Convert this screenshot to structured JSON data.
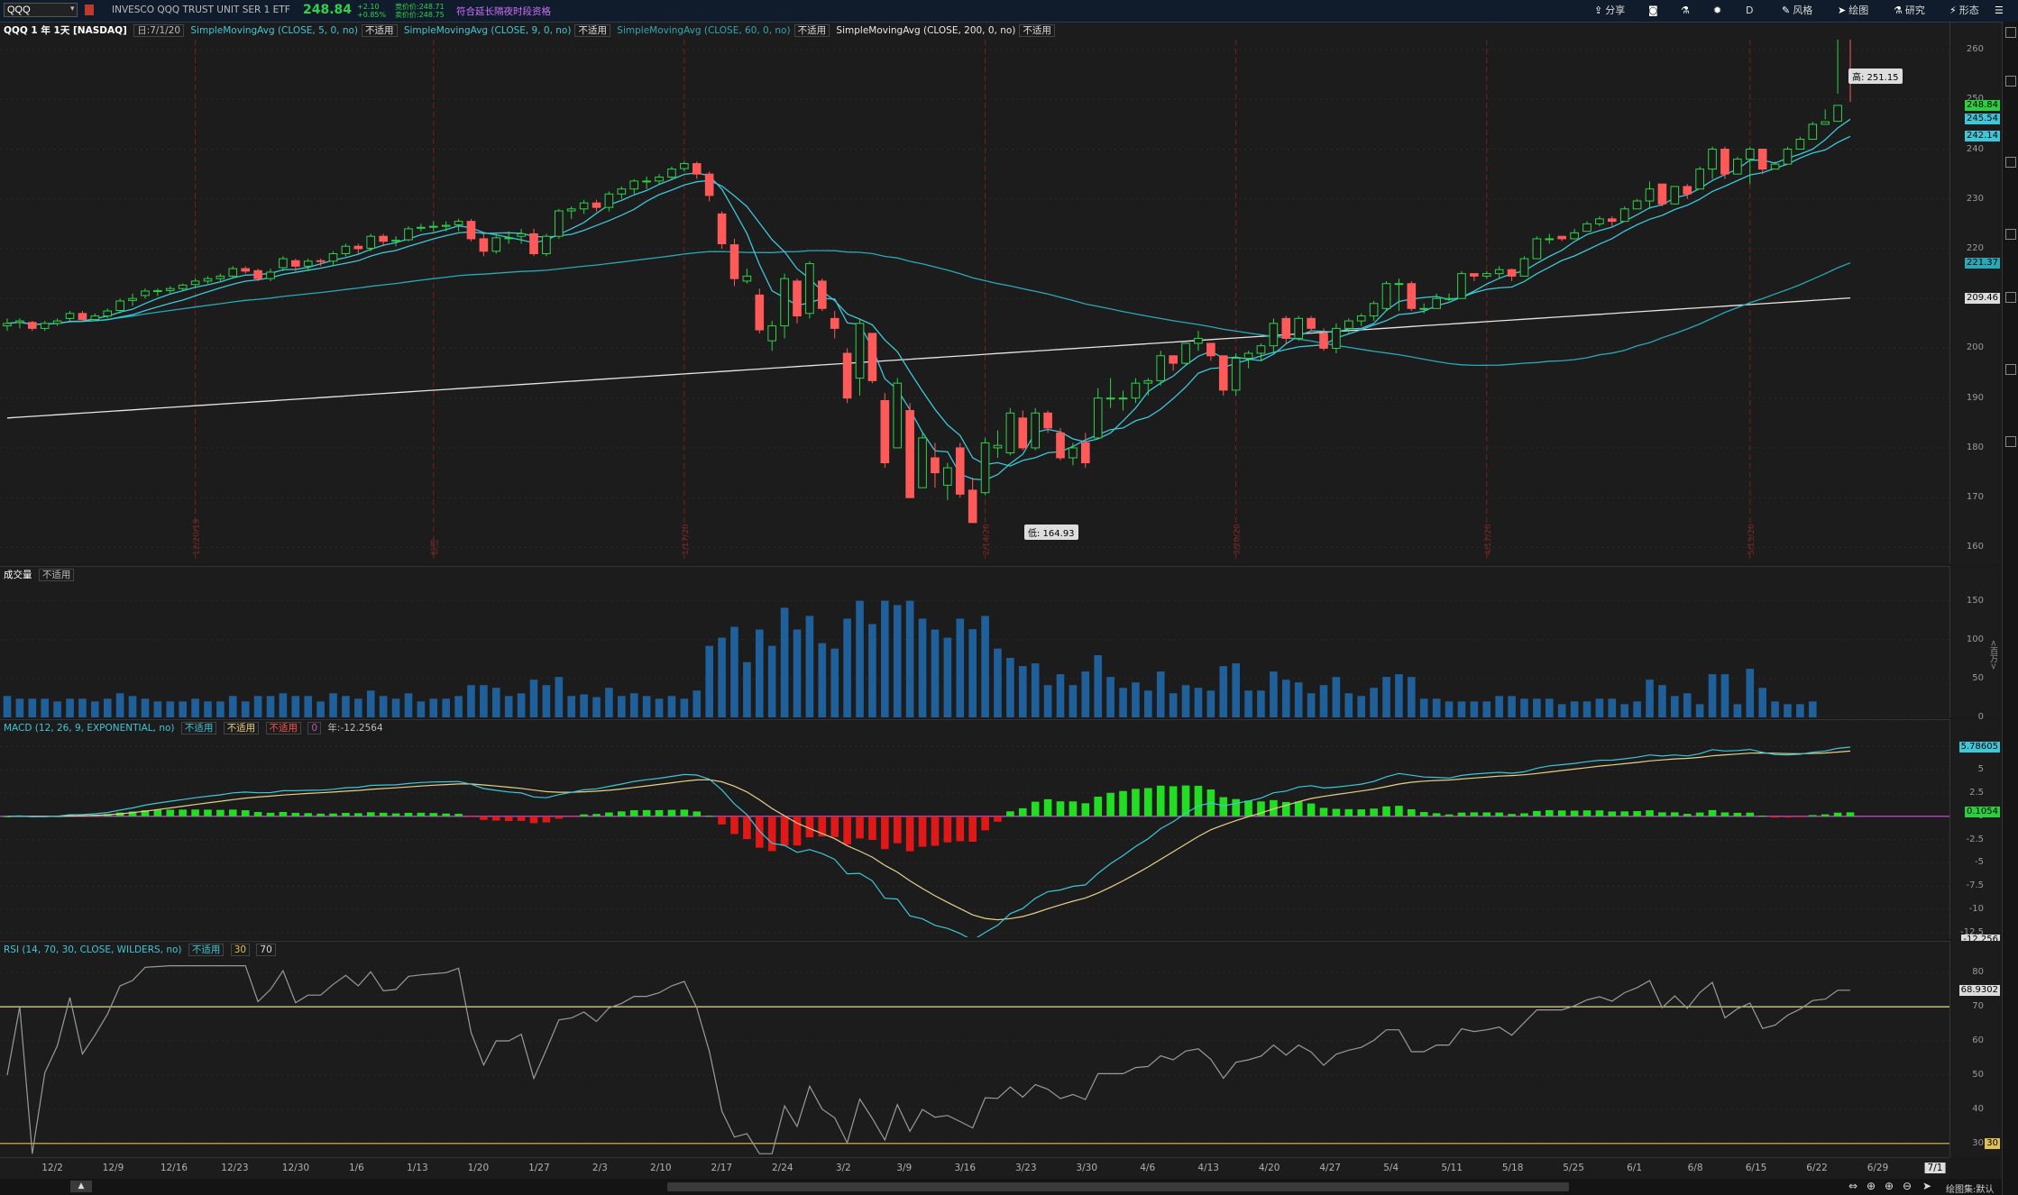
{
  "toolbar": {
    "symbol": "QQQ",
    "description": "INVESCO QQQ TRUST UNIT SER 1 ETF",
    "last": "248.84",
    "change": "+2.10",
    "change_pct": "+0.85%",
    "bid": "竞价价:248.71",
    "ask": "卖价价:248.75",
    "notice": "符合延长隔夜时段资格",
    "share_label": "分享",
    "style_label": "风格",
    "draw_label": "绘图",
    "study_label": "研究",
    "pattern_label": "形态",
    "period_label": "D"
  },
  "header": {
    "title": "QQQ 1 年 1天 [NASDAQ]",
    "date": "日:7/1/20",
    "studies": [
      {
        "name": "SimpleMovingAvg (CLOSE, 5, 0, no)",
        "value": "不适用"
      },
      {
        "name": "SimpleMovingAvg (CLOSE, 9, 0, no)",
        "value": "不适用"
      },
      {
        "name": "SimpleMovingAvg (CLOSE, 60, 0, no)",
        "value": "不适用"
      },
      {
        "name": "SimpleMovingAvg (CLOSE, 200, 0, no)",
        "value": "不适用"
      }
    ]
  },
  "price_panel": {
    "y_ticks": [
      "260",
      "250",
      "240",
      "230",
      "220",
      "210",
      "200",
      "190",
      "180",
      "170",
      "160"
    ],
    "high_label": "高: 251.15",
    "low_label": "低: 164.93",
    "badges": [
      {
        "text": "248.84",
        "color": "#29d040"
      },
      {
        "text": "245.54",
        "color": "#3fc6d8"
      },
      {
        "text": "242.14",
        "color": "#3fc6d8"
      },
      {
        "text": "221.37",
        "color": "#2aa8b8"
      },
      {
        "text": "209.46",
        "color": "#dcdcdc"
      }
    ],
    "vertical_date_labels": [
      "12/20/19",
      "标签",
      "1/17/20",
      "2/14/20",
      "3/20/20",
      "4/17/20",
      "5/15/20",
      "6/19/20"
    ]
  },
  "volume_panel": {
    "title": "成交量",
    "value": "不适用",
    "y_ticks": [
      "150",
      "100",
      "50",
      "0"
    ],
    "unit": "<百万>"
  },
  "macd_panel": {
    "title": "MACD (12, 26, 9, EXPONENTIAL, no)",
    "values": [
      "不适用",
      "不适用",
      "不适用"
    ],
    "zero": "0",
    "extra": "年:-12.2564",
    "y_ticks": [
      "7.5",
      "5",
      "2.5",
      "0",
      "-2.5",
      "-5",
      "-7.5",
      "-10",
      "-12.5"
    ],
    "badges": [
      {
        "text": "5.78605",
        "color": "#3fc6d8"
      },
      {
        "text": "0.1054",
        "color": "#29d040"
      },
      {
        "text": "-12.256",
        "color": "#dcdcdc"
      }
    ]
  },
  "rsi_panel": {
    "title": "RSI (14, 70, 30, CLOSE, WILDERS, no)",
    "value": "不适用",
    "lower": "30",
    "upper": "70",
    "y_ticks": [
      "80",
      "70",
      "60",
      "50",
      "40",
      "30"
    ],
    "badges": [
      {
        "text": "68.9302",
        "color": "#dcdcdc"
      },
      {
        "text": "30",
        "color": "#e0c050"
      }
    ]
  },
  "time_axis": {
    "labels": [
      "12/2",
      "12/9",
      "12/16",
      "12/23",
      "12/30",
      "1/6",
      "1/13",
      "1/20",
      "1/27",
      "2/3",
      "2/10",
      "2/17",
      "2/24",
      "3/2",
      "3/9",
      "3/16",
      "3/23",
      "3/30",
      "4/6",
      "4/13",
      "4/20",
      "4/27",
      "5/4",
      "5/11",
      "5/18",
      "5/25",
      "6/1",
      "6/8",
      "6/15",
      "6/22",
      "6/29",
      "7/1"
    ]
  },
  "footer": {
    "drawset_label": "绘图集:默认"
  },
  "chart_data": {
    "type": "candlestick",
    "title": "QQQ 1 年 1天 [NASDAQ]",
    "ylim": [
      157,
      262
    ],
    "dates": [
      "11/29",
      "12/2",
      "12/3",
      "12/4",
      "12/5",
      "12/6",
      "12/9",
      "12/10",
      "12/11",
      "12/12",
      "12/13",
      "12/16",
      "12/17",
      "12/18",
      "12/19",
      "12/20",
      "12/23",
      "12/24",
      "12/26",
      "12/27",
      "12/30",
      "12/31",
      "1/2",
      "1/3",
      "1/6",
      "1/7",
      "1/8",
      "1/9",
      "1/10",
      "1/13",
      "1/14",
      "1/15",
      "1/16",
      "1/17",
      "1/21",
      "1/22",
      "1/23",
      "1/24",
      "1/27",
      "1/28",
      "1/29",
      "1/30",
      "1/31",
      "2/3",
      "2/4",
      "2/5",
      "2/6",
      "2/7",
      "2/10",
      "2/11",
      "2/12",
      "2/13",
      "2/14",
      "2/18",
      "2/19",
      "2/20",
      "2/21",
      "2/24",
      "2/25",
      "2/26",
      "2/27",
      "2/28",
      "3/2",
      "3/3",
      "3/4",
      "3/5",
      "3/6",
      "3/9",
      "3/10",
      "3/11",
      "3/12",
      "3/13",
      "3/16",
      "3/17",
      "3/18",
      "3/19",
      "3/20",
      "3/23",
      "3/24",
      "3/25",
      "3/26",
      "3/27",
      "3/30",
      "3/31",
      "4/1",
      "4/2",
      "4/3",
      "4/6",
      "4/7",
      "4/8",
      "4/9",
      "4/13",
      "4/14",
      "4/15",
      "4/16",
      "4/17",
      "4/20",
      "4/21",
      "4/22",
      "4/23",
      "4/24",
      "4/27",
      "4/28",
      "4/29",
      "4/30",
      "5/1",
      "5/4",
      "5/5",
      "5/6",
      "5/7",
      "5/8",
      "5/11",
      "5/12",
      "5/13",
      "5/14",
      "5/15",
      "5/18",
      "5/19",
      "5/20",
      "5/21",
      "5/22",
      "5/26",
      "5/27",
      "5/28",
      "5/29",
      "6/1",
      "6/2",
      "6/3",
      "6/4",
      "6/5",
      "6/8",
      "6/9",
      "6/10",
      "6/11",
      "6/12",
      "6/15",
      "6/16",
      "6/17",
      "6/18",
      "6/19",
      "6/22",
      "6/23",
      "6/24",
      "6/25",
      "6/26",
      "6/29",
      "6/30",
      "7/1"
    ],
    "close": [
      205,
      205.5,
      204,
      205,
      205.5,
      207,
      205.8,
      206.5,
      207.5,
      209.5,
      210,
      211.5,
      211.6,
      212,
      212.7,
      213.5,
      214,
      214.5,
      216,
      215.5,
      214,
      215.3,
      218,
      216.5,
      217.5,
      217.5,
      219,
      220.5,
      220,
      222.5,
      221.5,
      221.7,
      224,
      224.3,
      224.5,
      224.7,
      225.5,
      222,
      219.5,
      222.2,
      222.2,
      223,
      219,
      222.5,
      227.6,
      228,
      229.2,
      228.3,
      231,
      232,
      233.6,
      233.6,
      234.4,
      236,
      237.1,
      235,
      230.7,
      221,
      214,
      214.5,
      203.7,
      204.5,
      214,
      206.5,
      217,
      208,
      204,
      190,
      205,
      193.5,
      177,
      193,
      170,
      182,
      175,
      176,
      170.7,
      165,
      181,
      180.5,
      187,
      180,
      187,
      184,
      178,
      180,
      177,
      190,
      190,
      190,
      193,
      193.5,
      198.5,
      197,
      201,
      202,
      198.5,
      191.6,
      198,
      199,
      200.5,
      205,
      202,
      206,
      204,
      200,
      204,
      205.5,
      206.5,
      209,
      213,
      213,
      208,
      208,
      210,
      210,
      215,
      214.5,
      215,
      215.8,
      214.5,
      218,
      222,
      222,
      222,
      223.2,
      225,
      226,
      225.5,
      228,
      229.6,
      232,
      229,
      232.5,
      231,
      236,
      240,
      235,
      238,
      240,
      236,
      237,
      240,
      242,
      245,
      245.5,
      248.8,
      248.8
    ],
    "open": [
      204.5,
      205.2,
      205.2,
      204,
      205,
      206,
      207,
      205.8,
      206.5,
      207.6,
      209.6,
      210.6,
      211.4,
      211.6,
      212,
      212.8,
      213.5,
      214,
      214.5,
      216,
      215.6,
      214,
      216.2,
      217.6,
      216.5,
      217.6,
      217.5,
      219,
      220.5,
      220.1,
      222.5,
      221.5,
      221.8,
      224.2,
      224.5,
      224.5,
      224.8,
      225.5,
      222,
      219.5,
      222.2,
      222.5,
      223,
      219,
      222.5,
      227.6,
      228,
      229.2,
      228.3,
      231,
      232,
      233.6,
      233.6,
      234.4,
      236.1,
      237.1,
      235,
      227,
      220.8,
      213.5,
      210.7,
      201.5,
      204.5,
      213.5,
      207,
      213.5,
      206,
      199,
      194,
      203,
      189.5,
      180,
      187.5,
      172,
      178,
      172.5,
      180,
      171.5,
      171,
      180,
      179,
      186,
      180,
      187,
      183,
      178,
      181,
      182,
      190,
      190,
      190,
      193,
      193.5,
      198.5,
      197,
      201,
      201,
      198.5,
      191.6,
      198,
      199,
      200.5,
      206,
      202,
      206,
      203,
      200,
      204,
      205.5,
      206.5,
      208,
      213,
      213,
      208,
      208,
      210,
      210,
      215,
      214.5,
      215,
      215.8,
      214.5,
      218,
      222,
      222.5,
      222,
      223.5,
      225,
      226,
      225.5,
      228,
      229.6,
      233,
      229,
      232.5,
      232,
      236,
      240,
      235,
      238,
      240,
      236,
      237,
      240,
      242,
      245,
      245.6
    ],
    "high": [
      206,
      206,
      205.5,
      205.5,
      206,
      207.5,
      207.5,
      207,
      208,
      210,
      211,
      212,
      212,
      212.5,
      213,
      214,
      214.5,
      215,
      216.5,
      216.5,
      216,
      216,
      218.5,
      218,
      218,
      218,
      219.5,
      221,
      221,
      223,
      223,
      222.5,
      224.5,
      225,
      225.5,
      225.5,
      226,
      226,
      223,
      223,
      223.5,
      224,
      224,
      223,
      228,
      228.5,
      229.8,
      229.8,
      231.5,
      232.5,
      234,
      234.5,
      235,
      236.5,
      237.5,
      237.5,
      235.5,
      227.5,
      222,
      216,
      212,
      205.5,
      215,
      214,
      217.5,
      214,
      207.5,
      200,
      206,
      203,
      191,
      194,
      189,
      183,
      181,
      177,
      181,
      174,
      182,
      183.5,
      188,
      187.5,
      188,
      187.5,
      184,
      181,
      183,
      192,
      194,
      191.5,
      194,
      194,
      199.5,
      198.5,
      201,
      203.5,
      201,
      198.5,
      199,
      199.5,
      201,
      206,
      206.5,
      206.5,
      206.5,
      204,
      205,
      206,
      207,
      209.5,
      213.5,
      214,
      213.5,
      209,
      211,
      211,
      215.5,
      215,
      215.5,
      216.5,
      216,
      218.5,
      222.5,
      223,
      222.5,
      224,
      225.5,
      226.5,
      226.5,
      228.5,
      230,
      233.5,
      233,
      232.5,
      233,
      236.5,
      240.5,
      240.5,
      238.5,
      240.5,
      239,
      237.5,
      240.5,
      242.5,
      245.5,
      246,
      251.15,
      249.5
    ],
    "low": [
      203.5,
      204,
      203.5,
      203.5,
      204.5,
      205.5,
      205.5,
      205.5,
      206,
      207,
      208.5,
      210,
      210.5,
      211,
      211.5,
      212,
      213,
      213.5,
      214,
      215,
      213.5,
      213.5,
      215.5,
      215.5,
      215.5,
      216.5,
      216.5,
      218.5,
      219,
      219.5,
      220.5,
      220.5,
      221.5,
      223.5,
      223.5,
      223.5,
      223.5,
      221.5,
      218.5,
      219,
      221,
      221,
      218.5,
      218.5,
      222,
      226,
      227,
      227.5,
      227.5,
      230,
      231,
      232,
      233,
      234,
      235.5,
      234,
      229.5,
      220,
      212.5,
      213,
      203,
      199.5,
      202,
      205,
      206,
      207.5,
      202,
      189,
      190.5,
      193,
      176,
      180.5,
      170,
      172,
      172,
      169.5,
      170,
      164.93,
      170.5,
      178,
      178.5,
      179.5,
      179.5,
      183,
      177.5,
      176.5,
      176,
      182,
      188,
      187.5,
      189,
      190.5,
      192.5,
      195.5,
      196.5,
      199.5,
      197.5,
      190.5,
      190.5,
      196,
      197.5,
      199,
      201,
      201.5,
      203.5,
      199.5,
      199,
      203,
      204.5,
      205.5,
      207.5,
      207.5,
      207.5,
      207,
      209,
      209.5,
      214,
      213.5,
      214,
      214,
      213.5,
      216.5,
      220.5,
      221,
      221.5,
      222.5,
      224,
      224.5,
      224.5,
      227.5,
      228.5,
      228,
      228.5,
      230,
      230,
      235.5,
      234,
      234,
      237.5,
      233,
      235,
      236,
      239.5,
      241.5,
      244,
      248
    ]
  }
}
